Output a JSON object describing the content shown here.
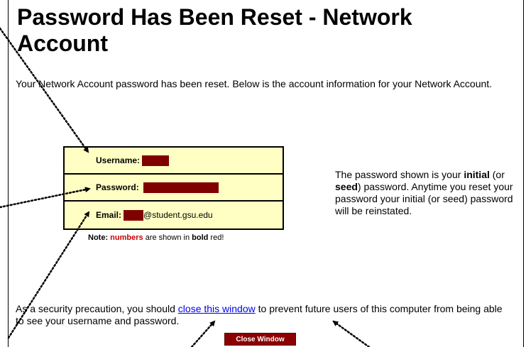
{
  "page": {
    "title": "Password Has Been Reset - Network Account",
    "intro": "Your Network Account password has been reset. Below is the account information for your Network Account."
  },
  "account": {
    "username_label": "Username:",
    "password_label": "Password:",
    "email_label": "Email:",
    "email_suffix": "@student.gsu.edu",
    "redaction_color": "#800000"
  },
  "note": {
    "prefix": "Note:",
    "numbers": "numbers",
    "mid": "are shown in",
    "bold": "bold",
    "suffix": "red!"
  },
  "side": {
    "t1": "The password shown is your ",
    "b1": "initial",
    "t2": " (or ",
    "b2": "seed",
    "t3": ") password. Anytime you reset your password your initial (or seed) password will be reinstated."
  },
  "security": {
    "before": "As a security precaution, you should ",
    "link": "close this window",
    "after": " to prevent future users of this computer from being able to see your username and password."
  },
  "close_button_label": "Close Window"
}
